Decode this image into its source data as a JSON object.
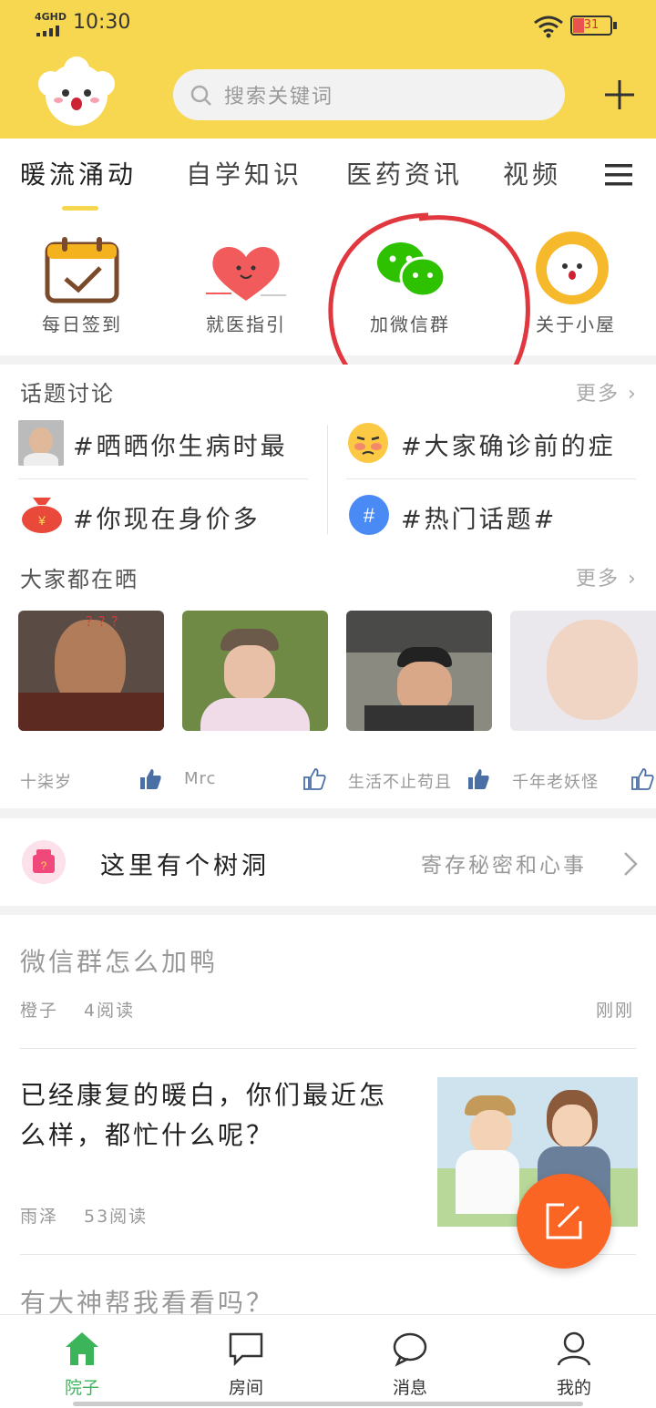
{
  "status": {
    "network": "4GHD",
    "time": "10:30",
    "battery": "31"
  },
  "search": {
    "placeholder": "搜索关键词"
  },
  "tabs": [
    "暖流涌动",
    "自学知识",
    "医药资讯",
    "视频"
  ],
  "quick_actions": [
    "每日签到",
    "就医指引",
    "加微信群",
    "关于小屋"
  ],
  "topics": {
    "title": "话题讨论",
    "more": "更多",
    "items": [
      "#晒晒你生病时最",
      "#大家确诊前的症",
      "#你现在身价多",
      "#热门话题#"
    ]
  },
  "photos": {
    "title": "大家都在晒",
    "more": "更多",
    "items": [
      {
        "user": "十柒岁",
        "caption": "？？？"
      },
      {
        "user": "Mrc"
      },
      {
        "user": "生活不止苟且"
      },
      {
        "user": "千年老妖怪"
      }
    ]
  },
  "treehole": {
    "title": "这里有个树洞",
    "subtitle": "寄存秘密和心事"
  },
  "posts": [
    {
      "title": "微信群怎么加鸭",
      "author": "橙子",
      "reads": "4阅读",
      "time": "刚刚"
    },
    {
      "title": "已经康复的暖白，你们最近怎么样，都忙什么呢？",
      "author": "雨泽",
      "reads": "53阅读"
    },
    {
      "title": "有大神帮我看看吗？"
    }
  ],
  "nav": [
    "院子",
    "房间",
    "消息",
    "我的"
  ],
  "colors": {
    "brand_yellow": "#f7d74f",
    "active_green": "#3cb55a",
    "fab_orange": "#fb6524",
    "annotation_red": "#e0383e"
  }
}
